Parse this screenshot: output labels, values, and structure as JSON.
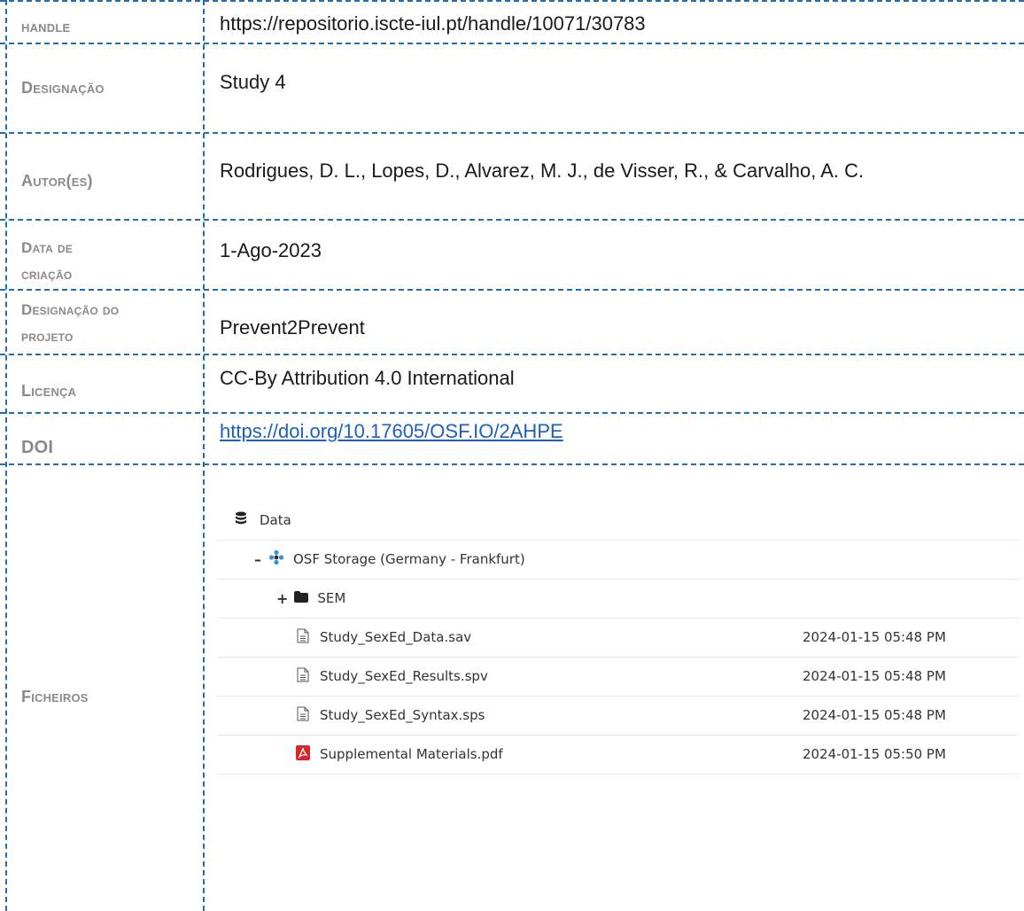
{
  "rows": {
    "handle": {
      "label": "handle",
      "value": "https://repositorio.iscte-iul.pt/handle/10071/30783"
    },
    "designacao": {
      "label": "Designação",
      "value": "Study 4"
    },
    "autores": {
      "label": "Autor(es)",
      "value": "Rodrigues, D. L., Lopes, D., Alvarez, M. J., de Visser, R., & Carvalho, A. C."
    },
    "data_criacao": {
      "label_line1": "Data de",
      "label_line2": "criação",
      "value": "1-Ago-2023"
    },
    "projeto": {
      "label_line1": "Designação do",
      "label_line2": "projeto",
      "value": "Prevent2Prevent"
    },
    "licenca": {
      "label": "Licença",
      "value": "CC-By Attribution 4.0 International"
    },
    "doi": {
      "label": "DOI",
      "value": "https://doi.org/10.17605/OSF.IO/2AHPE"
    },
    "ficheiros": {
      "label": "Ficheiros"
    }
  },
  "file_browser": {
    "root": {
      "name": "Data",
      "icon": "database-icon"
    },
    "storage": {
      "name": "OSF Storage (Germany - Frankfurt)",
      "icon": "osf-storage-icon",
      "toggle": "–"
    },
    "folder": {
      "name": "SEM",
      "icon": "folder-icon",
      "toggle": "+"
    },
    "files": [
      {
        "name": "Study_SexEd_Data.sav",
        "date": "2024-01-15 05:48 PM",
        "icon": "file-icon"
      },
      {
        "name": "Study_SexEd_Results.spv",
        "date": "2024-01-15 05:48 PM",
        "icon": "file-icon"
      },
      {
        "name": "Study_SexEd_Syntax.sps",
        "date": "2024-01-15 05:48 PM",
        "icon": "file-icon"
      },
      {
        "name": "Supplemental Materials.pdf",
        "date": "2024-01-15 05:50 PM",
        "icon": "pdf-icon"
      }
    ]
  },
  "colors": {
    "border": "#1f6fb2",
    "label": "#8a8a8a",
    "link": "#1e5fbf",
    "pdf": "#d9262b"
  }
}
